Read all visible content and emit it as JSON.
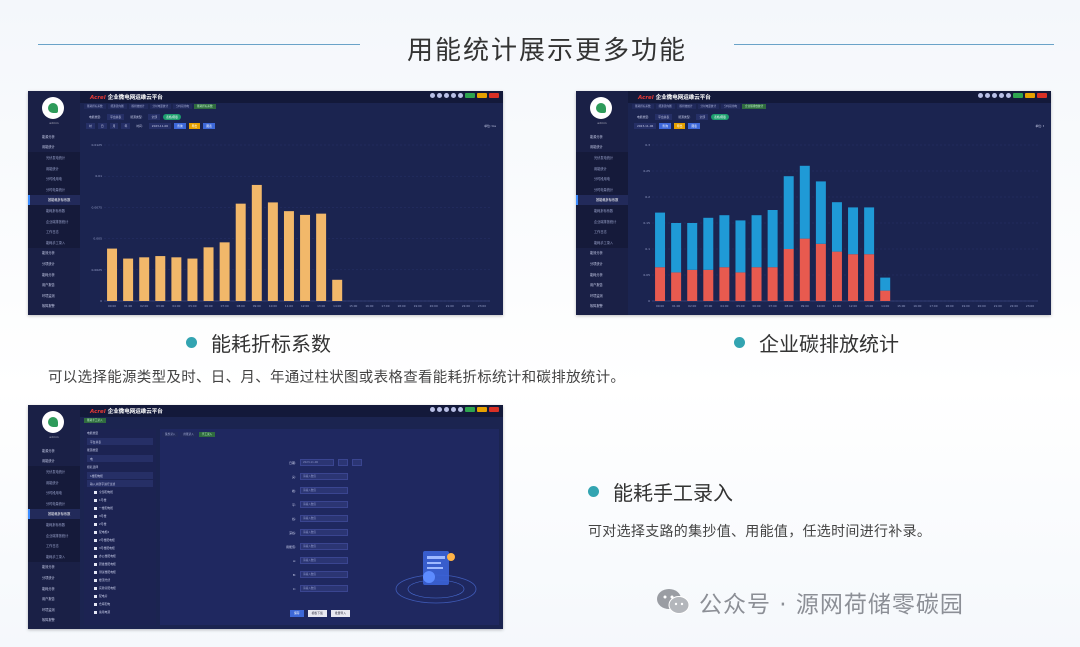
{
  "header": {
    "title": "用能统计展示更多功能"
  },
  "app": {
    "brand_logo": "Acrel",
    "brand_title": "企业微电网运维云平台",
    "user": "admin",
    "menu_top": [
      "能源分析",
      "用能统计"
    ],
    "menu_sub": [
      "光伏发电统计",
      "用能统计",
      "分时段用电",
      "分时电量统计",
      "按能耗折标系数",
      "能耗折标系数",
      "企业碳排放统计",
      "工作日志",
      "能耗手工录入"
    ],
    "menu_bottom": [
      "能效分析",
      "分项统计",
      "能耗分析",
      "用户报告",
      "环境监测",
      "故障报警"
    ]
  },
  "section1": {
    "title": "能耗折标系数",
    "filter": {
      "area_label": "电能类型:",
      "area_value": "平台总表",
      "energy_label": "能源类型:",
      "energy_value": "全部",
      "periods": [
        "时",
        "日",
        "月",
        "年"
      ],
      "date_label": "时间:",
      "date_value": "2023-11-06",
      "query": "查询",
      "export": "导出",
      "chart_btn": "图表",
      "toggle": "表格/图表",
      "unit": "单位: tce"
    },
    "tabs": [
      "能耗折标系数",
      "能源流向图",
      "碳排放统计",
      "分时电量统计",
      "分时段用电",
      "能耗折标系数"
    ]
  },
  "section2": {
    "title": "企业碳排放统计",
    "filter": {
      "area_label": "电能类型:",
      "area_value": "平台总表",
      "energy_label": "能源类型:",
      "energy_value": "全部",
      "date_value": "2023-11-06",
      "query": "查询",
      "export": "导出",
      "chart_btn": "图表",
      "toggle": "表格/图表",
      "unit": "单位: t"
    },
    "tabs": [
      "能耗折标系数",
      "能源流向图",
      "碳排放统计",
      "分时电量统计",
      "分时段用电",
      "企业碳排放统计"
    ]
  },
  "section3": {
    "title": "能耗手工录入",
    "left": {
      "label1": "电能类型",
      "value1": "平台总表",
      "label2": "能源类型",
      "value2": "电",
      "label3": "组名选择",
      "value3": "1楼配电柜",
      "search": "输入关键字进行过滤",
      "tree": [
        "全部配电柜",
        "1号楼",
        "一楼配电柜",
        "3号楼",
        "2号楼",
        "配电柜2",
        "2号楼配电柜",
        "3号楼配电柜",
        "办公楼配电柜",
        "研发楼配电柜",
        "测试楼配电柜",
        "楼顶光伏",
        "实验室配电柜",
        "配电房",
        "仓库配电",
        "备用电源"
      ]
    },
    "tabs": [
      "集抄录入",
      "用能录入",
      "手工录入",
      "能耗手工录入"
    ],
    "form": {
      "time_label": "日期:",
      "time_value": "2023-11-06",
      "fields": [
        {
          "label": "尖:",
          "placeholder": "请输入数值"
        },
        {
          "label": "峰:",
          "placeholder": "请输入数值"
        },
        {
          "label": "平:",
          "placeholder": "请输入数值"
        },
        {
          "label": "谷:",
          "placeholder": "请输入数值"
        },
        {
          "label": "深谷:",
          "placeholder": "请输入数值"
        },
        {
          "label": "用能值:",
          "placeholder": "请输入数值"
        },
        {
          "label": "A:",
          "placeholder": "请输入数值"
        },
        {
          "label": "B:",
          "placeholder": "请输入数值"
        },
        {
          "label": "C:",
          "placeholder": "请输入数值"
        }
      ],
      "btn_save": "保存",
      "btn_template": "模板下载",
      "btn_import": "批量导入"
    },
    "desc": "可对选择支路的集抄值、用能值，任选时间进行补录。"
  },
  "desc_main": "可以选择能源类型及时、日、月、年通过柱状图或表格查看能耗折标统计和碳排放统计。",
  "watermark": "公众号 · 源网荷储零碳园",
  "chart_data": [
    {
      "type": "bar",
      "title": "",
      "categories": [
        "00:00",
        "01:00",
        "02:00",
        "03:00",
        "04:00",
        "05:00",
        "06:00",
        "07:00",
        "08:00",
        "09:00",
        "10:00",
        "11:00",
        "12:00",
        "13:00",
        "14:00",
        "15:00",
        "16:00",
        "17:00",
        "18:00",
        "19:00",
        "20:00",
        "21:00",
        "22:00",
        "23:00"
      ],
      "series": [
        {
          "name": "",
          "values": [
            0.0042,
            0.0034,
            0.0035,
            0.0036,
            0.0035,
            0.0034,
            0.0043,
            0.0047,
            0.0078,
            0.0093,
            0.0079,
            0.0072,
            0.0069,
            0.007,
            0.0017,
            null,
            null,
            null,
            null,
            null,
            null,
            null,
            null,
            null
          ]
        }
      ],
      "ylim": [
        0,
        0.0125
      ],
      "yticks": [
        "0",
        "0.0025",
        "0.005",
        "0.0075",
        "0.01",
        "0.0125"
      ],
      "color": "#f2b86a",
      "ylabel": "tce"
    },
    {
      "type": "bar",
      "title": "",
      "categories": [
        "00:00",
        "01:00",
        "02:00",
        "03:00",
        "04:00",
        "05:00",
        "06:00",
        "07:00",
        "08:00",
        "09:00",
        "10:00",
        "11:00",
        "12:00",
        "13:00",
        "14:00",
        "15:00",
        "16:00",
        "17:00",
        "18:00",
        "19:00",
        "20:00",
        "21:00",
        "22:00",
        "23:00"
      ],
      "stacked": true,
      "series": [
        {
          "name": "",
          "color": "#e85a4f",
          "values": [
            0.065,
            0.055,
            0.06,
            0.06,
            0.065,
            0.055,
            0.065,
            0.065,
            0.1,
            0.12,
            0.11,
            0.095,
            0.09,
            0.09,
            0.02,
            null,
            null,
            null,
            null,
            null,
            null,
            null,
            null,
            null
          ]
        },
        {
          "name": "",
          "color": "#1f9ad6",
          "values": [
            0.105,
            0.095,
            0.09,
            0.1,
            0.1,
            0.1,
            0.1,
            0.11,
            0.14,
            0.14,
            0.12,
            0.095,
            0.09,
            0.09,
            0.025,
            null,
            null,
            null,
            null,
            null,
            null,
            null,
            null,
            null
          ]
        }
      ],
      "ylim": [
        0,
        0.3
      ],
      "yticks": [
        "0",
        "0.05",
        "0.1",
        "0.15",
        "0.2",
        "0.25",
        "0.3"
      ],
      "ylabel": "t"
    }
  ]
}
